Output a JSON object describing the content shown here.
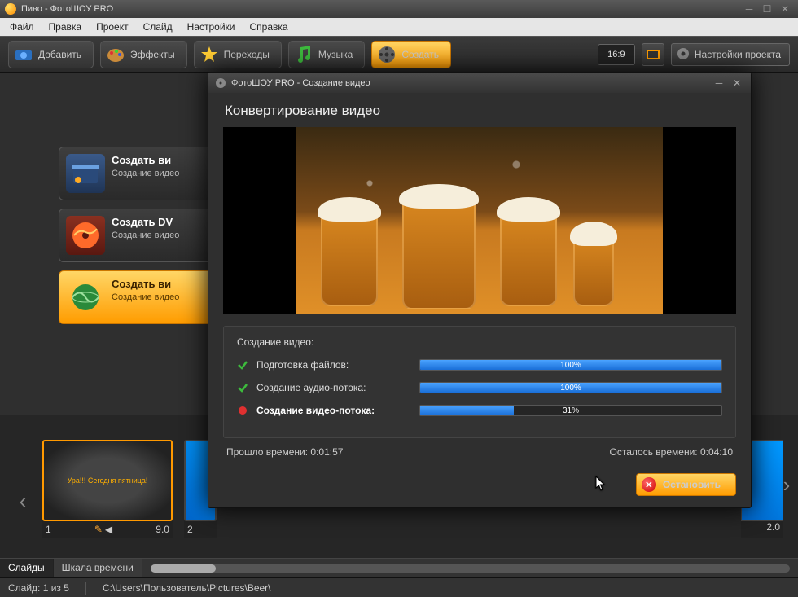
{
  "window": {
    "title": "Пиво - ФотоШОУ PRO"
  },
  "menu": {
    "file": "Файл",
    "edit": "Правка",
    "project": "Проект",
    "slide": "Слайд",
    "settings": "Настройки",
    "help": "Справка"
  },
  "toolbar": {
    "add": "Добавить",
    "effects": "Эффекты",
    "transitions": "Переходы",
    "music": "Музыка",
    "create": "Создать",
    "aspect": "16:9",
    "project_settings": "Настройки проекта"
  },
  "cards": {
    "video": {
      "title": "Создать ви",
      "sub": "Создание видео"
    },
    "dvd": {
      "title": "Создать DV",
      "sub": "Создание видео"
    },
    "web": {
      "title": "Создать ви",
      "sub": "Создание видео"
    }
  },
  "timeline": {
    "tab_slides": "Слайды",
    "tab_timecale": "Шкала времени",
    "thumb1": {
      "caption": "Ура!!! Сегодня пятница!",
      "index": "1",
      "dur": "9.0"
    },
    "thumb2": {
      "index": "2"
    },
    "thumb_r": {
      "dur": "2.0"
    }
  },
  "status": {
    "slide": "Слайд: 1 из 5",
    "path": "C:\\Users\\Пользователь\\Pictures\\Beer\\"
  },
  "dialog": {
    "title": "ФотоШОУ PRO - Создание видео",
    "heading": "Конвертирование видео",
    "progress_heading": "Создание видео:",
    "rows": {
      "prepare": {
        "label": "Подготовка файлов:",
        "pct_text": "100%",
        "pct": 100
      },
      "audio": {
        "label": "Создание аудио-потока:",
        "pct_text": "100%",
        "pct": 100
      },
      "video": {
        "label": "Создание видео-потока:",
        "pct_text": "31%",
        "pct": 31
      }
    },
    "elapsed_label": "Прошло времени:",
    "elapsed": "0:01:57",
    "remaining_label": "Осталось времени:",
    "remaining": "0:04:10",
    "stop": "Остановить"
  }
}
